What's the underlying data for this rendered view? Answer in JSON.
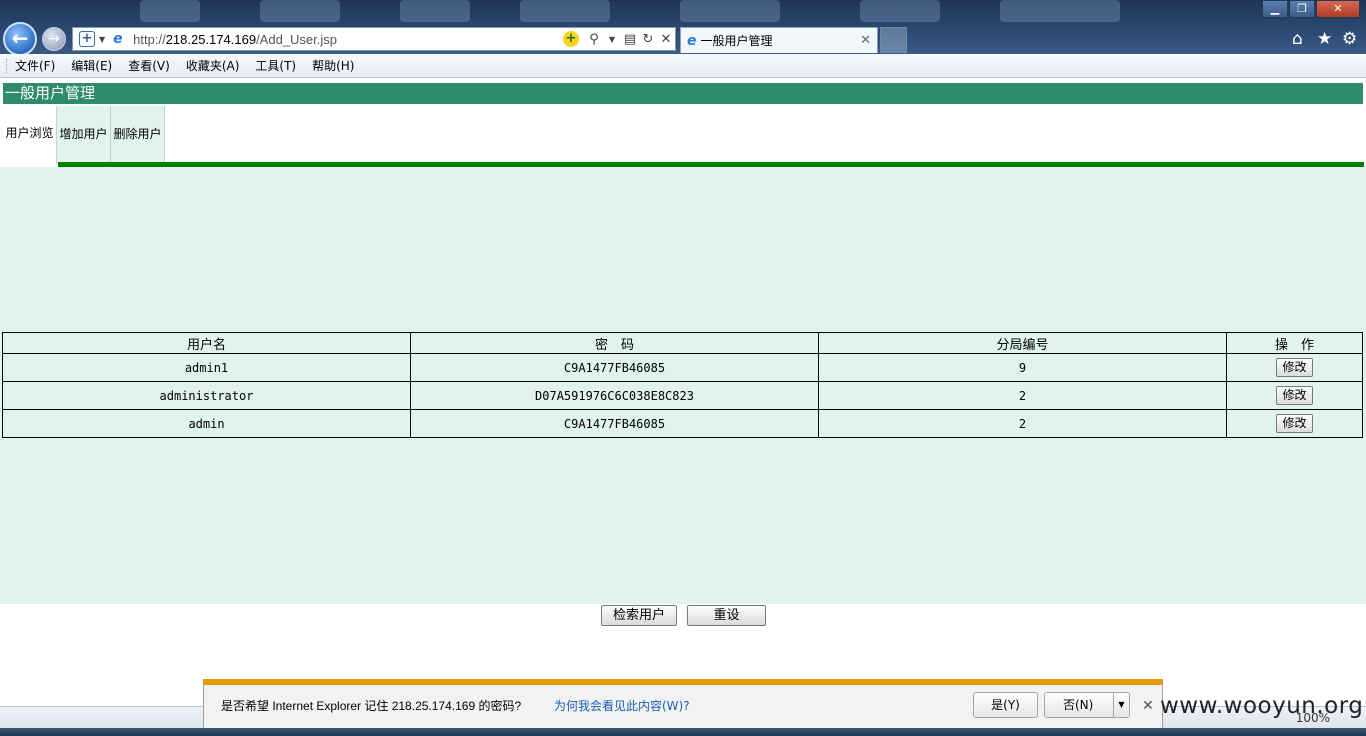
{
  "browser": {
    "url_prefix": "http://",
    "url_host": "218.25.174.169",
    "url_path": "/Add_User.jsp",
    "tab_title": "一般用户管理",
    "window_controls": [
      "minimize",
      "restore",
      "close"
    ]
  },
  "menu": [
    "文件(F)",
    "编辑(E)",
    "查看(V)",
    "收藏夹(A)",
    "工具(T)",
    "帮助(H)"
  ],
  "page": {
    "title": "一般用户管理",
    "tabs": [
      "用户浏览",
      "增加用户",
      "删除用户"
    ],
    "active_tab": "用户浏览"
  },
  "table": {
    "headers": [
      "用户名",
      "密　码",
      "分局编号",
      "操　作"
    ],
    "rows": [
      {
        "username": "admin1",
        "password": "C9A1477FB46085",
        "branch": "9",
        "action": "修改"
      },
      {
        "username": "administrator",
        "password": "D07A591976C6C038E8C823",
        "branch": "2",
        "action": "修改"
      },
      {
        "username": "admin",
        "password": "C9A1477FB46085",
        "branch": "2",
        "action": "修改"
      }
    ]
  },
  "form": {
    "search_label": "检索用户",
    "reset_label": "重设"
  },
  "password_bar": {
    "message": "是否希望 Internet Explorer 记住 218.25.174.169 的密码?",
    "link": "为何我会看见此内容(W)?",
    "yes": "是(Y)",
    "no": "否(N)"
  },
  "status": {
    "zoom": "100%"
  },
  "watermark": "www.wooyun.org",
  "colors": {
    "header_green": "#2e8b6e",
    "panel_mint": "#e0f3ec",
    "tab_underline": "#008000",
    "notification_orange": "#e89b00"
  }
}
